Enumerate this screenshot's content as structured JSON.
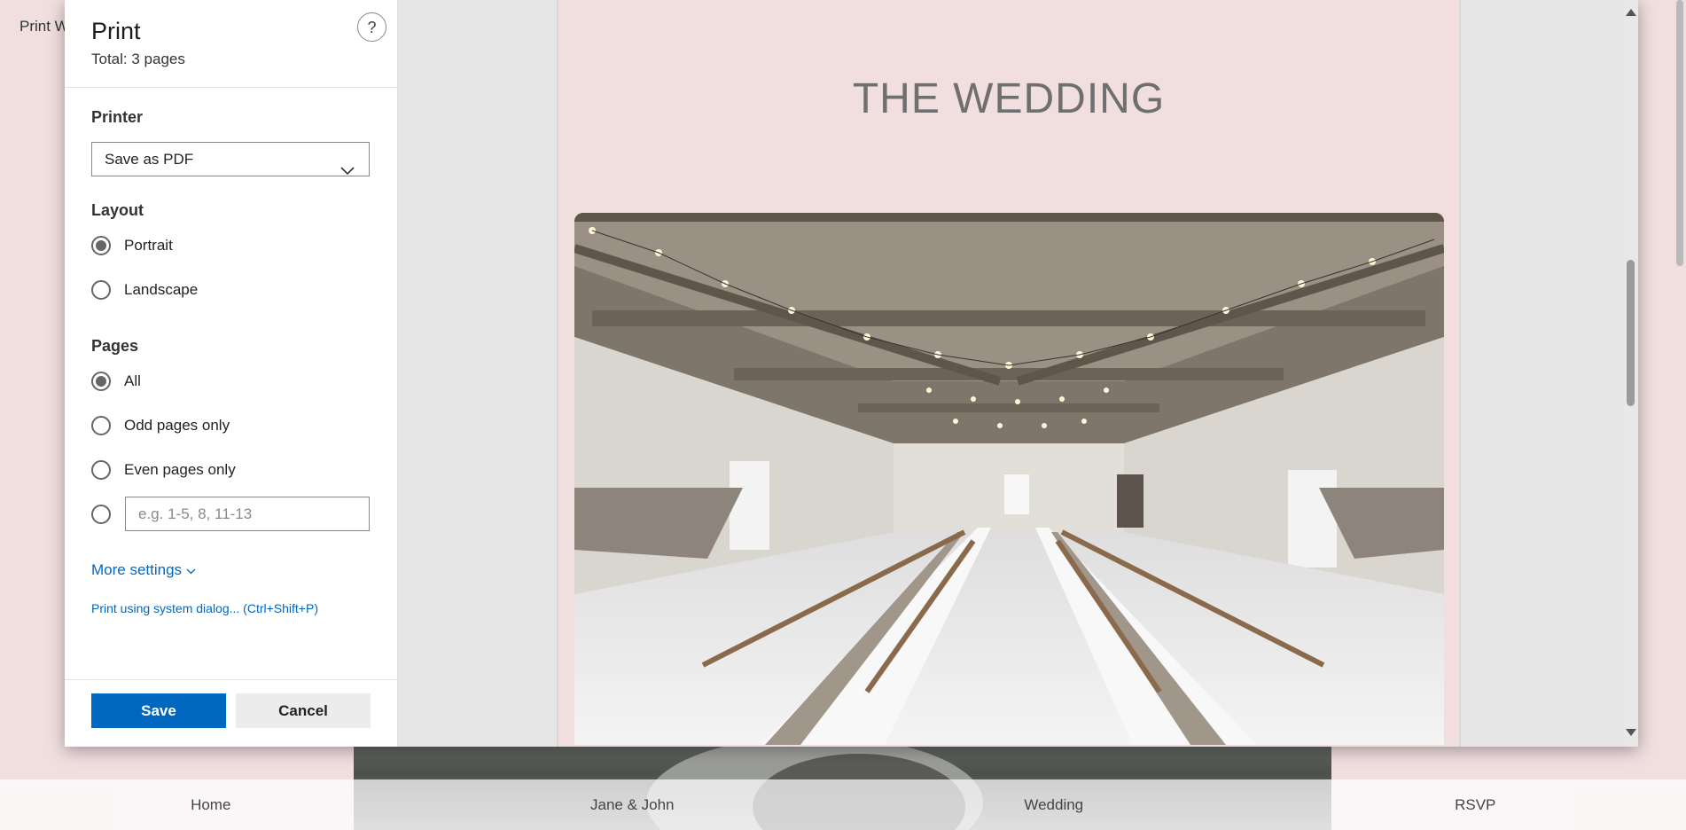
{
  "background": {
    "page_title": "Print W",
    "nav": [
      "Home",
      "Jane & John",
      "Wedding",
      "RSVP"
    ]
  },
  "dialog": {
    "title": "Print",
    "total": "Total: 3 pages",
    "help_label": "?",
    "printer": {
      "label": "Printer",
      "value": "Save as PDF"
    },
    "layout": {
      "label": "Layout",
      "options": [
        {
          "label": "Portrait",
          "selected": true
        },
        {
          "label": "Landscape",
          "selected": false
        }
      ]
    },
    "pages": {
      "label": "Pages",
      "options": [
        {
          "label": "All",
          "selected": true
        },
        {
          "label": "Odd pages only",
          "selected": false
        },
        {
          "label": "Even pages only",
          "selected": false
        }
      ],
      "custom_placeholder": "e.g. 1-5, 8, 11-13"
    },
    "more_settings": "More settings",
    "system_dialog": "Print using system dialog... (Ctrl+Shift+P)",
    "save_label": "Save",
    "cancel_label": "Cancel"
  },
  "preview": {
    "heading": "THE WEDDING"
  },
  "colors": {
    "accent": "#0067c0",
    "page_background": "#f1dfe0"
  }
}
